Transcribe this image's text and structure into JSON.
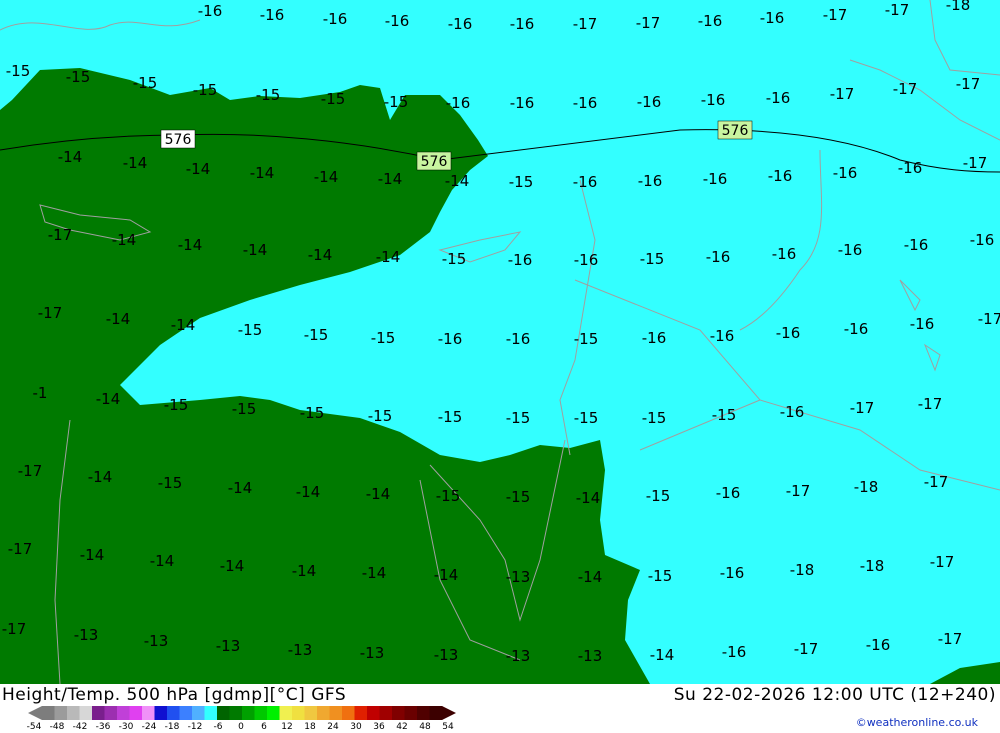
{
  "header": {
    "product": "Height/Temp. 500 hPa [gdmp][°C] GFS",
    "valid_time": "Su 22-02-2026 12:00 UTC (12+240)",
    "credit": "©weatheronline.co.uk"
  },
  "colors": {
    "warm_fill": "#007a00",
    "cold_fill": "#33ffff",
    "contour_line": "#000000",
    "border_line": "#a0a0a0",
    "height_label_bg_a": "#ffffff",
    "height_label_bg_b": "#c8f5a0"
  },
  "height_contours": [
    {
      "label": "576"
    },
    {
      "label": "576"
    },
    {
      "label": "576"
    }
  ],
  "temperature_labels": [
    "-16",
    "-16",
    "-16",
    "-16",
    "-16",
    "-16",
    "-17",
    "-17",
    "-16",
    "-16",
    "-17",
    "-17",
    "-18",
    "-15",
    "-15",
    "-15",
    "-15",
    "-15",
    "-15",
    "-15",
    "-16",
    "-16",
    "-16",
    "-16",
    "-16",
    "-16",
    "-17",
    "-17",
    "-17",
    "-14",
    "-14",
    "-14",
    "-14",
    "-14",
    "-14",
    "-14",
    "-15",
    "-16",
    "-16",
    "-16",
    "-16",
    "-16",
    "-16",
    "-17",
    "-17",
    "-14",
    "-14",
    "-14",
    "-14",
    "-14",
    "-15",
    "-16",
    "-16",
    "-15",
    "-16",
    "-16",
    "-16",
    "-16",
    "-16",
    "-17",
    "-14",
    "-14",
    "-15",
    "-15",
    "-15",
    "-16",
    "-16",
    "-15",
    "-16",
    "-16",
    "-16",
    "-16",
    "-16",
    "-17",
    "-1",
    "-14",
    "-15",
    "-15",
    "-15",
    "-15",
    "-15",
    "-15",
    "-15",
    "-15",
    "-15",
    "-16",
    "-17",
    "-17",
    "-17",
    "-14",
    "-15",
    "-14",
    "-14",
    "-14",
    "-15",
    "-15",
    "-14",
    "-15",
    "-16",
    "-17",
    "-18",
    "-17",
    "-17",
    "-14",
    "-14",
    "-14",
    "-14",
    "-14",
    "-14",
    "-13",
    "-14",
    "-15",
    "-16",
    "-18",
    "-18",
    "-17",
    "-17",
    "-13",
    "-13",
    "-13",
    "-13",
    "-13",
    "-13",
    "-13",
    "-13",
    "-14",
    "-16",
    "-17",
    "-16",
    "-17",
    "-16"
  ],
  "legend": {
    "scale_values": [
      "-54",
      "-48",
      "-42",
      "-36",
      "-30",
      "-24",
      "-18",
      "-12",
      "-6",
      "0",
      "6",
      "12",
      "18",
      "24",
      "30",
      "36",
      "42",
      "48",
      "54"
    ],
    "colors": [
      "#7d7d7d",
      "#9b9b9b",
      "#b9b9b9",
      "#d7d7d7",
      "#7a1f8c",
      "#9c2fb0",
      "#c040d8",
      "#e040f0",
      "#f090f8",
      "#1010d0",
      "#2050f0",
      "#3c80ff",
      "#50b0ff",
      "#33ffff",
      "#006400",
      "#007a00",
      "#00a000",
      "#00c800",
      "#00f000",
      "#f0f050",
      "#f0e040",
      "#f0c840",
      "#f0a830",
      "#f09020",
      "#f07010",
      "#e02000",
      "#c00000",
      "#a00000",
      "#800000",
      "#6a0000",
      "#500000",
      "#3c0000"
    ]
  }
}
